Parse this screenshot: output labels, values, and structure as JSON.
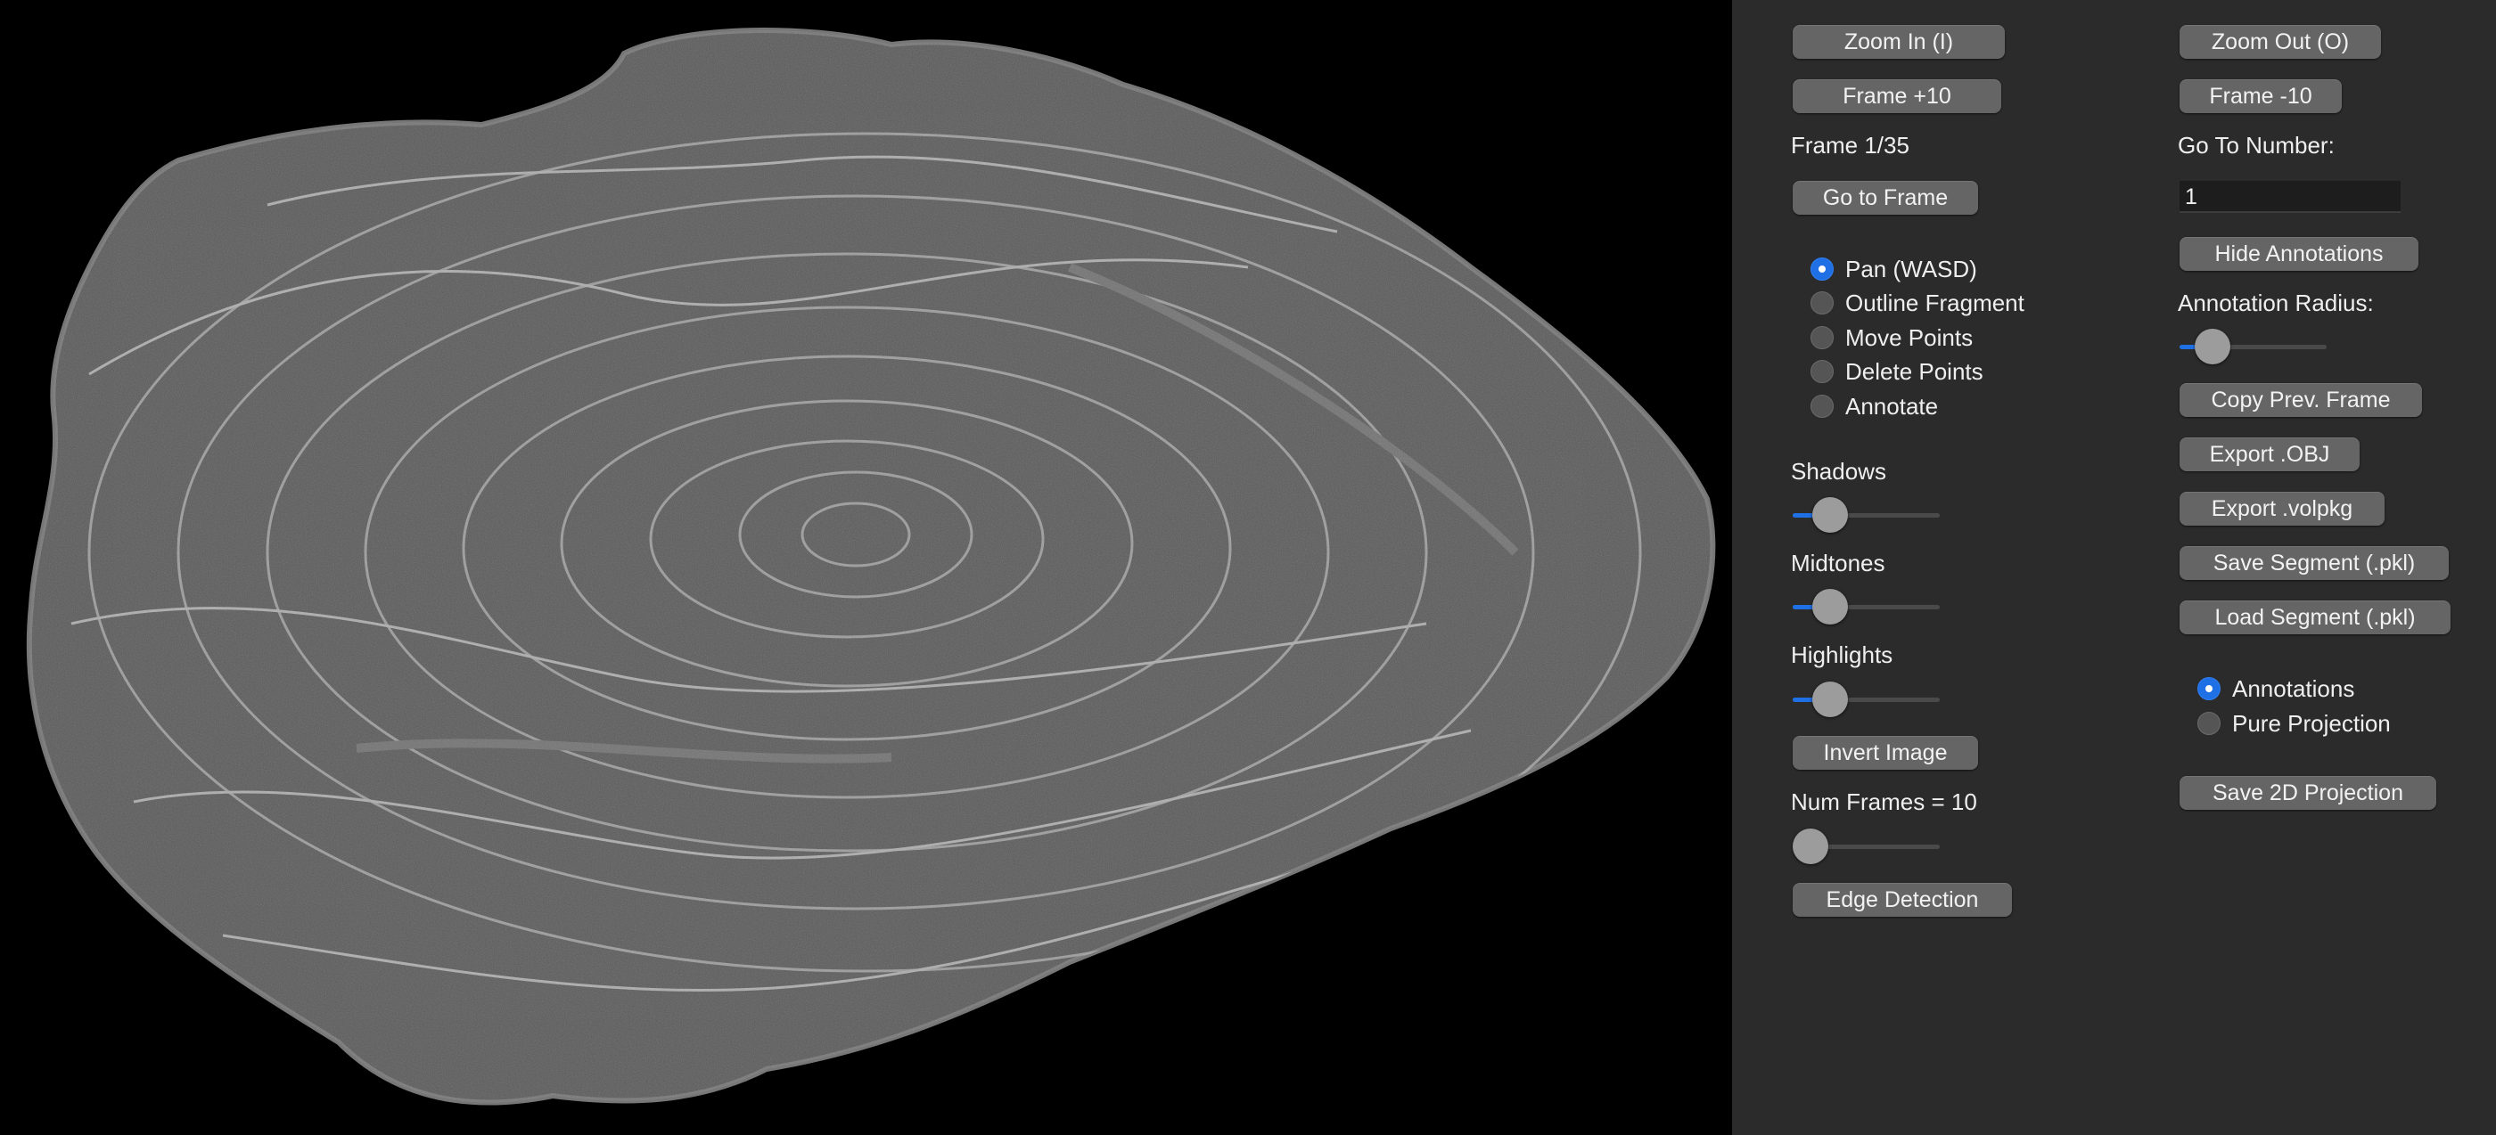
{
  "viewer": {
    "image": "scroll-cross-section-ct-slice"
  },
  "controls": {
    "zoom_in": "Zoom In (I)",
    "zoom_out": "Zoom Out (O)",
    "frame_plus": "Frame +10",
    "frame_minus": "Frame -10",
    "frame_status": "Frame 1/35",
    "goto_number_label": "Go To Number:",
    "goto_number_value": "1",
    "goto_frame": "Go to Frame",
    "hide_annotations": "Hide Annotations",
    "annotation_radius_label": "Annotation Radius:",
    "annotation_radius_level": 0.15,
    "copy_prev_frame": "Copy Prev. Frame",
    "export_obj": "Export .OBJ",
    "export_volpkg": "Export .volpkg",
    "save_segment": "Save Segment (.pkl)",
    "load_segment": "Load Segment (.pkl)",
    "invert_image": "Invert Image",
    "num_frames_label": "Num Frames = 10",
    "num_frames_level": 0.05,
    "edge_detection": "Edge Detection",
    "save_2d_projection": "Save 2D Projection"
  },
  "modes": {
    "selected": "Pan (WASD)",
    "items": [
      "Pan (WASD)",
      "Outline Fragment",
      "Move Points",
      "Delete Points",
      "Annotate"
    ]
  },
  "view_modes": {
    "selected": "Annotations",
    "items": [
      "Annotations",
      "Pure Projection"
    ]
  },
  "adjustments": {
    "shadows_label": "Shadows",
    "shadows_level": 0.18,
    "midtones_label": "Midtones",
    "midtones_level": 0.18,
    "highlights_label": "Highlights",
    "highlights_level": 0.18
  },
  "colors": {
    "accent": "#1f6fe5",
    "panel": "#2b2b2b",
    "button": "#656565"
  }
}
